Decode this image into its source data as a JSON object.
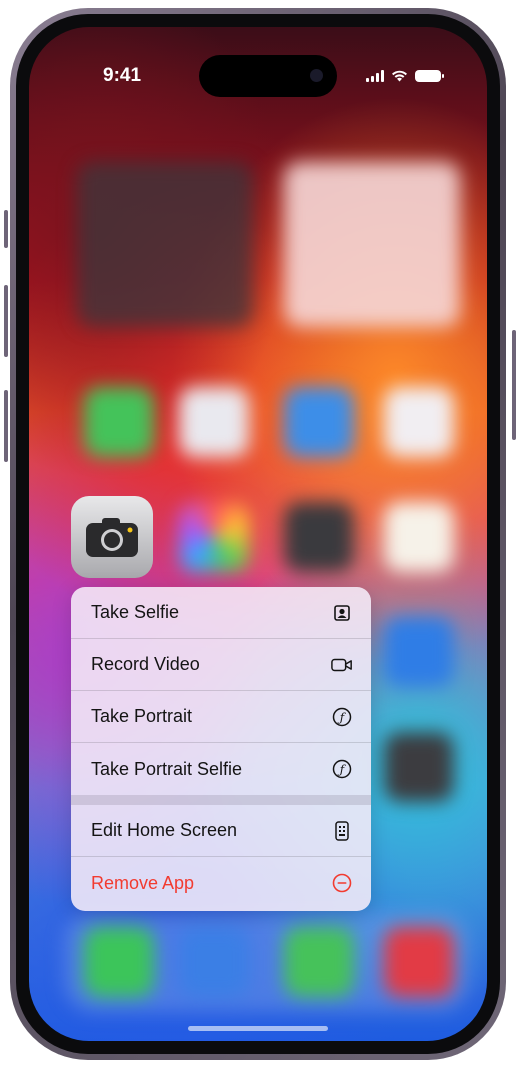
{
  "status_bar": {
    "time": "9:41"
  },
  "home_app": {
    "name": "Camera",
    "icon": "camera-icon"
  },
  "context_menu": {
    "quick_actions": [
      {
        "label": "Take Selfie",
        "icon": "selfie-icon"
      },
      {
        "label": "Record Video",
        "icon": "video-camera-icon"
      },
      {
        "label": "Take Portrait",
        "icon": "portrait-f-icon"
      },
      {
        "label": "Take Portrait Selfie",
        "icon": "portrait-f-icon"
      }
    ],
    "system_actions": [
      {
        "label": "Edit Home Screen",
        "icon": "phone-grid-icon"
      },
      {
        "label": "Remove App",
        "icon": "minus-circle-icon",
        "color": "#f23b30"
      }
    ]
  }
}
